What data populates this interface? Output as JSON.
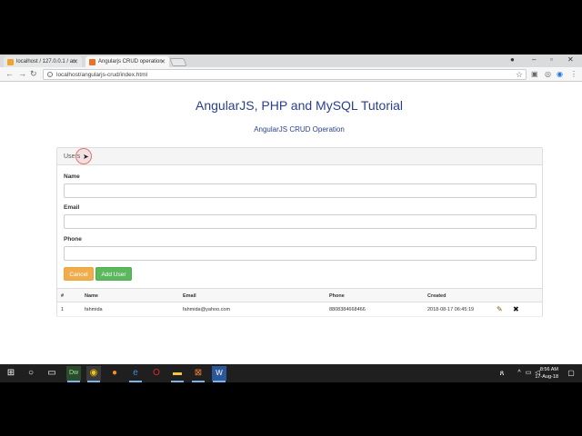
{
  "browser": {
    "tabs": [
      {
        "title": "localhost / 127.0.0.1 / an",
        "favicon_color": "#f0a32e"
      },
      {
        "title": "Angularjs CRUD operation",
        "favicon_color": "#e8722a"
      }
    ],
    "address": "localhost/angularjs-crud/index.html"
  },
  "page": {
    "title": "AngularJS, PHP and MySQL Tutorial",
    "subtitle": "AngularJS CRUD Operation"
  },
  "panel": {
    "heading": "Users",
    "fields": [
      {
        "label": "Name",
        "value": ""
      },
      {
        "label": "Email",
        "value": ""
      },
      {
        "label": "Phone",
        "value": ""
      }
    ],
    "cancel_label": "Cancel",
    "add_label": "Add User"
  },
  "table": {
    "headers": [
      "#",
      "Name",
      "Email",
      "Phone",
      "Created"
    ],
    "rows": [
      [
        "1",
        "fahmida",
        "fahmida@yahoo.com",
        "8808384668466",
        "2018-08-17 06:45:19"
      ]
    ]
  },
  "taskbar": {
    "time": "8:56 AM",
    "date": "17-Aug-18"
  }
}
